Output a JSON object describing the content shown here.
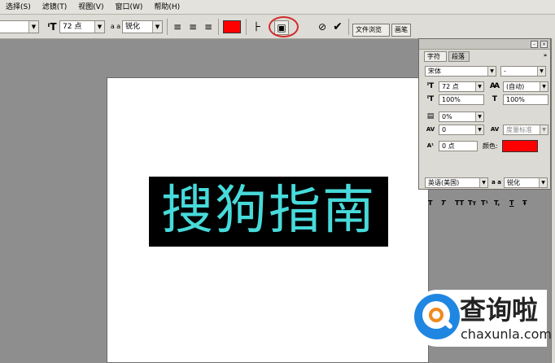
{
  "menubar": {
    "items": [
      "选择(S)",
      "滤镜(T)",
      "视图(V)",
      "窗口(W)",
      "帮助(H)"
    ]
  },
  "toolbar": {
    "font_size_value": "72 点",
    "aa_label": "a a",
    "antialias_value": "锐化",
    "color_swatch": "#ff0000",
    "tabs": [
      "文件浏览",
      "画笔"
    ]
  },
  "canvas": {
    "text": "搜狗指南",
    "text_color": "#47dada",
    "bg": "#000000"
  },
  "char_panel": {
    "tabs": [
      "字符",
      "段落"
    ],
    "font_family": "宋体",
    "font_style": "-",
    "font_size": "72 点",
    "leading": "(自动)",
    "vscale": "100%",
    "hscale": "100%",
    "tracking": "0%",
    "kerning": "0",
    "baseline_method": "度量标准",
    "baseline_shift": "0 点",
    "color_label": "颜色:",
    "color_value": "#ff0000",
    "style_buttons": [
      "T",
      "T",
      "TT",
      "Tт",
      "T¹",
      "T,",
      "T",
      "Ŧ"
    ],
    "language": "英语(美国)",
    "aa_label": "a a",
    "antialias": "锐化"
  },
  "watermark": {
    "title": "查询啦",
    "sub": "chaxunla.com",
    "logo_letter": "Q"
  }
}
